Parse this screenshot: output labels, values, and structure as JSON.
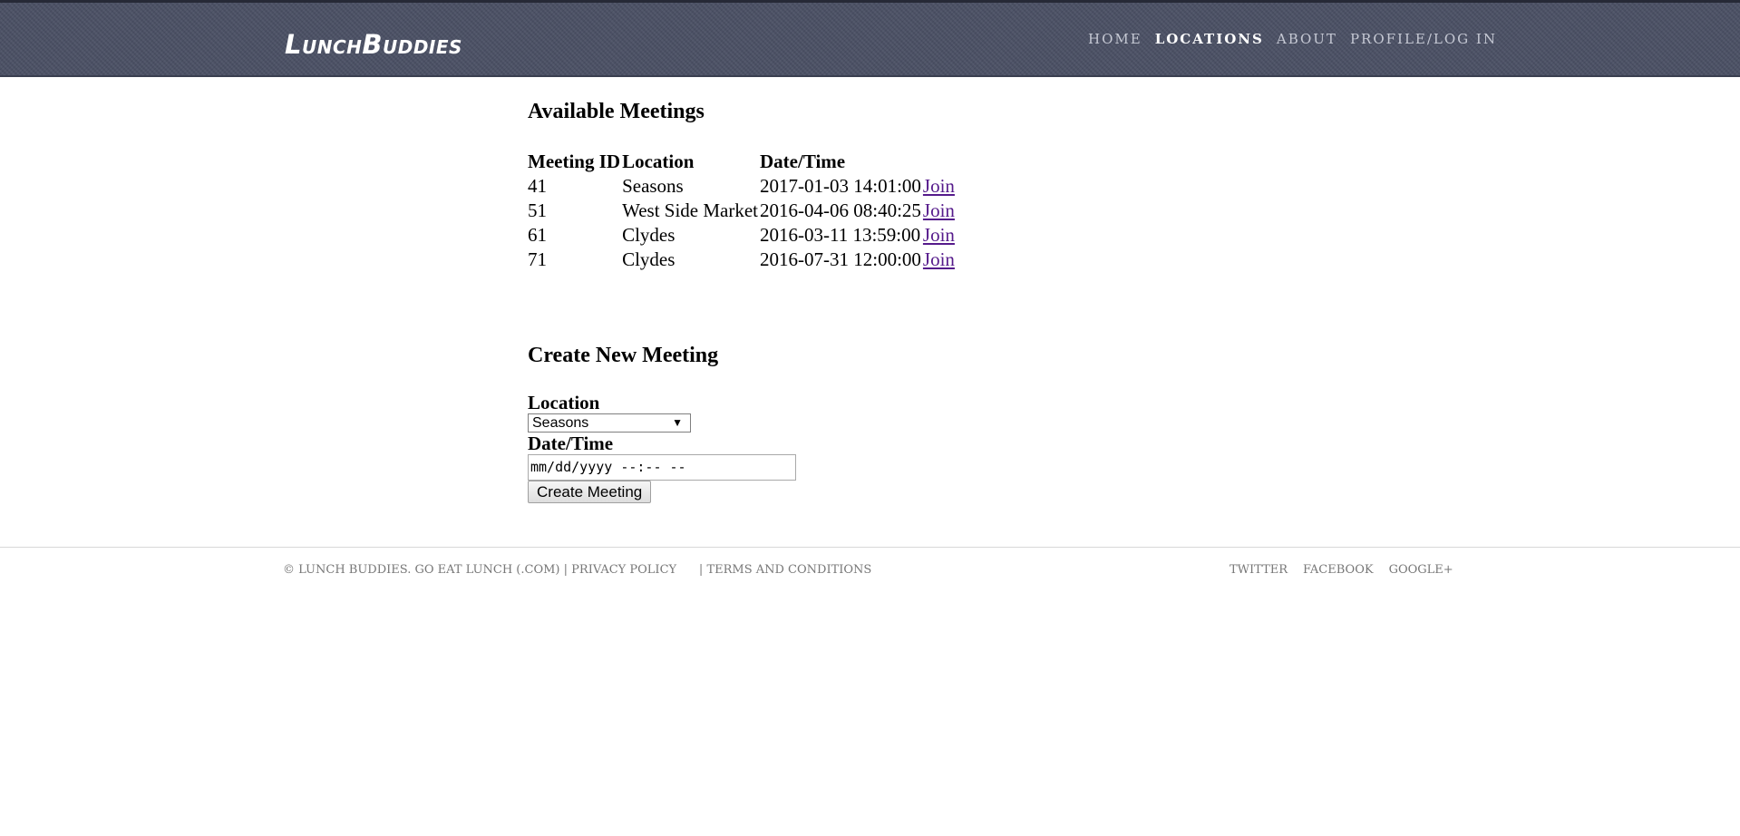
{
  "header": {
    "logo": "LunchBuddies",
    "nav": [
      {
        "label": "Home"
      },
      {
        "label": "Locations",
        "active": true
      },
      {
        "label": "About"
      },
      {
        "label": "Profile/Log in"
      }
    ]
  },
  "meetings": {
    "title": "Available Meetings",
    "columns": [
      "Meeting ID",
      "Location",
      "Date/Time"
    ],
    "rows": [
      {
        "id": "41",
        "location": "Seasons",
        "datetime": "2017-01-03 14:01:00",
        "action": "Join"
      },
      {
        "id": "51",
        "location": "West Side Market",
        "datetime": "2016-04-06 08:40:25",
        "action": "Join"
      },
      {
        "id": "61",
        "location": "Clydes",
        "datetime": "2016-03-11 13:59:00",
        "action": "Join"
      },
      {
        "id": "71",
        "location": "Clydes",
        "datetime": "2016-07-31 12:00:00",
        "action": "Join"
      }
    ]
  },
  "create": {
    "title": "Create New Meeting",
    "location_label": "Location",
    "location_value": "Seasons",
    "datetime_label": "Date/Time",
    "datetime_placeholder": "mm/dd/yyyy --:-- --",
    "submit_label": "Create Meeting"
  },
  "footer": {
    "copyright": "© Lunch Buddies. Go Eat Lunch (.com)",
    "sep1": "|",
    "privacy": "Privacy Policy",
    "sep2": "|",
    "terms": "Terms and Conditions",
    "social": [
      "Twitter",
      "Facebook",
      "Google+"
    ]
  },
  "colors": {
    "header_bg": "#4a5064",
    "link_visited": "#551a8b"
  }
}
